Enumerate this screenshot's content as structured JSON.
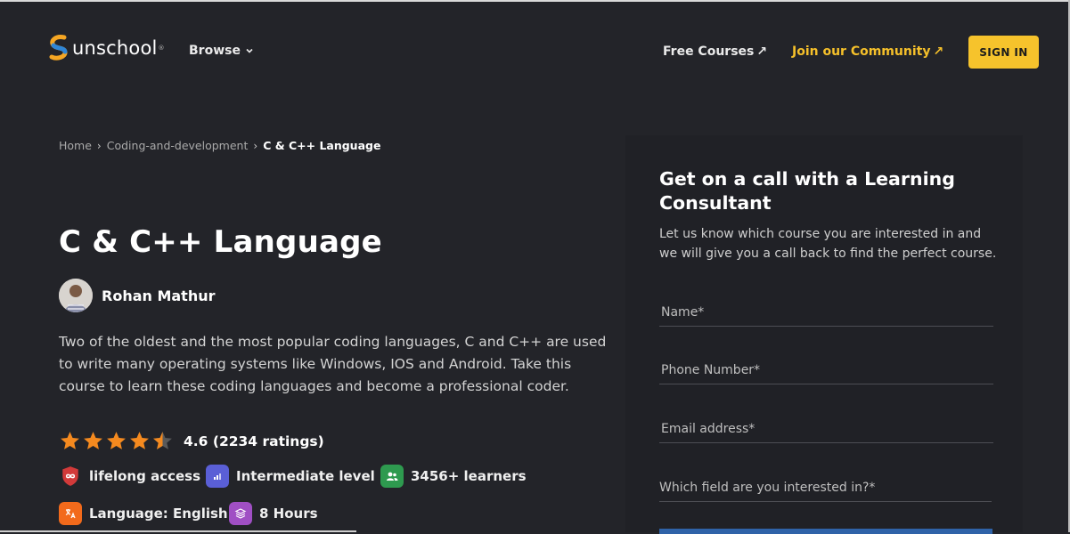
{
  "header": {
    "logo_text": "unschool",
    "logo_mark": "®",
    "browse_label": "Browse",
    "free_courses_label": "Free Courses",
    "join_label": "Join our Community",
    "signin_label": "SIGN IN",
    "arrow_icon": "↗"
  },
  "breadcrumb": {
    "items": [
      "Home",
      "Coding-and-development",
      "C & C++ Language"
    ],
    "separator": "›"
  },
  "course": {
    "title": "C & C++ Language",
    "author": "Rohan Mathur",
    "description": "Two of the oldest and the most popular coding languages, C and C++ are used to write many operating systems like Windows, IOS and Android. Take this course to learn these coding languages and become a professional coder.",
    "rating_value": 4.6,
    "rating_text": "4.6 (2234 ratings)",
    "features": [
      {
        "label": "lifelong access",
        "icon": "infinity-shield-icon",
        "color": "#d23a3a"
      },
      {
        "label": "Intermediate level",
        "icon": "bar-level-icon",
        "color": "#5a5fd6"
      },
      {
        "label": "3456+ learners",
        "icon": "users-icon",
        "color": "#2e9a4f"
      },
      {
        "label": "Language: English",
        "icon": "translate-icon",
        "color": "#f26a1b"
      },
      {
        "label": "8 Hours",
        "icon": "stack-icon",
        "color": "#a04fc4"
      }
    ]
  },
  "consultant_form": {
    "title": "Get on a call with a Learning Consultant",
    "subtitle": "Let us know which course you are interested in and we will give you a call back to find the perfect course.",
    "name_placeholder": "Name*",
    "phone_placeholder": "Phone Number*",
    "email_placeholder": "Email address*",
    "field_placeholder": "Which field are you interested in?*"
  },
  "colors": {
    "background": "#232429",
    "accent_yellow": "#f6c32c",
    "star_orange": "#f58a1f"
  }
}
